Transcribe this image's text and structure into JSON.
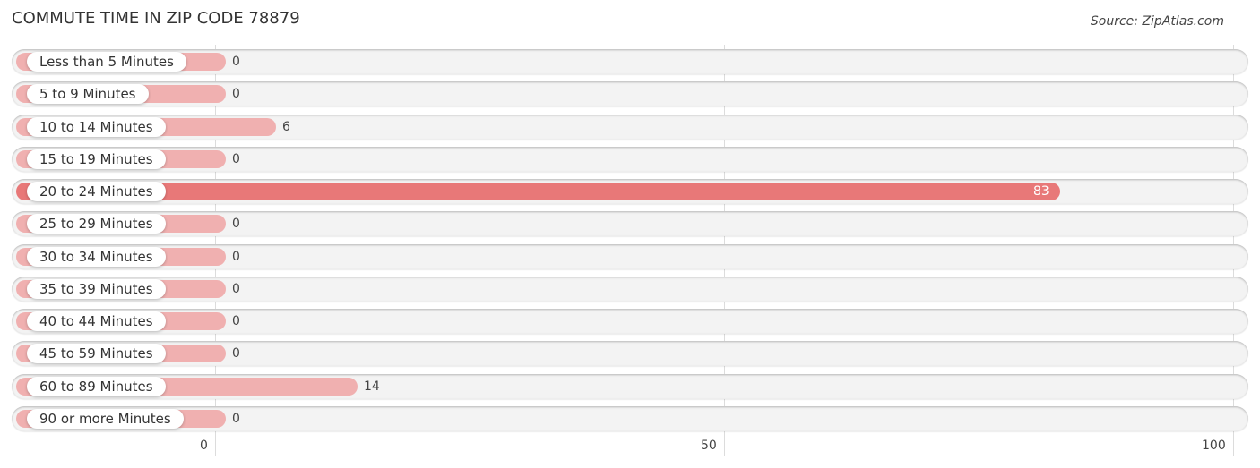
{
  "header": {
    "title": "COMMUTE TIME IN ZIP CODE 78879",
    "source": "Source: ZipAtlas.com"
  },
  "colors": {
    "bar_light": "#f0b0b0",
    "bar_highlight": "#e87878",
    "track": "#f3f3f3"
  },
  "chart_data": {
    "type": "bar",
    "orientation": "horizontal",
    "title": "COMMUTE TIME IN ZIP CODE 78879",
    "xlabel": "",
    "ylabel": "",
    "xlim": [
      0,
      100
    ],
    "xticks": [
      "0",
      "50",
      "100"
    ],
    "grid": true,
    "highlight_index": 4,
    "categories": [
      "Less than 5 Minutes",
      "5 to 9 Minutes",
      "10 to 14 Minutes",
      "15 to 19 Minutes",
      "20 to 24 Minutes",
      "25 to 29 Minutes",
      "30 to 34 Minutes",
      "35 to 39 Minutes",
      "40 to 44 Minutes",
      "45 to 59 Minutes",
      "60 to 89 Minutes",
      "90 or more Minutes"
    ],
    "values": [
      0,
      0,
      6,
      0,
      83,
      0,
      0,
      0,
      0,
      0,
      14,
      0
    ],
    "value_labels": [
      "0",
      "0",
      "6",
      "0",
      "83",
      "0",
      "0",
      "0",
      "0",
      "0",
      "14",
      "0"
    ]
  }
}
